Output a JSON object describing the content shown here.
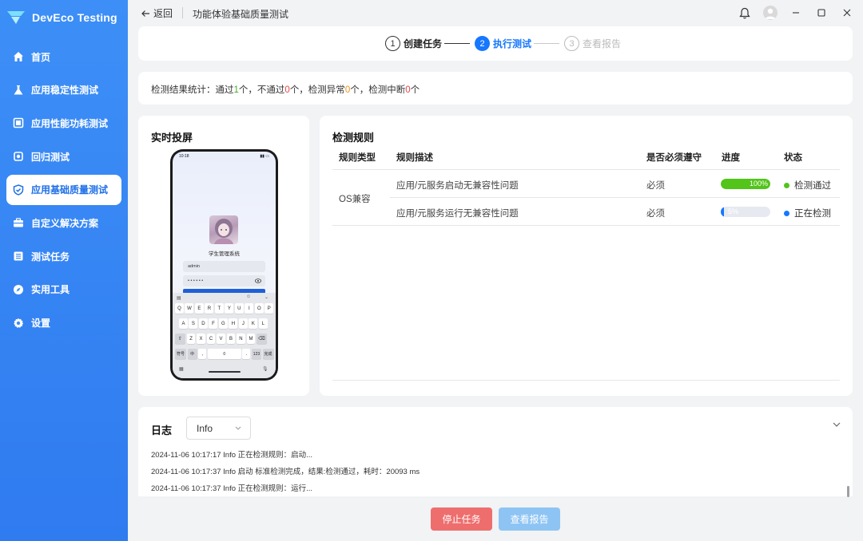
{
  "app": {
    "name": "DevEco Testing"
  },
  "sidebar": {
    "items": [
      {
        "label": "首页",
        "icon": "home-icon"
      },
      {
        "label": "应用稳定性测试",
        "icon": "flask-icon"
      },
      {
        "label": "应用性能功耗测试",
        "icon": "monitor-icon"
      },
      {
        "label": "回归测试",
        "icon": "refresh-icon"
      },
      {
        "label": "应用基础质量测试",
        "icon": "shield-check-icon",
        "active": true
      },
      {
        "label": "自定义解决方案",
        "icon": "toolbox-icon"
      },
      {
        "label": "测试任务",
        "icon": "list-icon"
      },
      {
        "label": "实用工具",
        "icon": "compass-icon"
      },
      {
        "label": "设置",
        "icon": "gear-icon"
      }
    ]
  },
  "titlebar": {
    "back_label": "返回",
    "page_title": "功能体验基础质量测试"
  },
  "steps": [
    {
      "num": "1",
      "label": "创建任务",
      "state": "done"
    },
    {
      "num": "2",
      "label": "执行测试",
      "state": "active"
    },
    {
      "num": "3",
      "label": "查看报告",
      "state": "pending"
    }
  ],
  "summary": {
    "prefix": "检测结果统计：通过",
    "pass_count": "1",
    "after_pass": "个，不通过",
    "fail_count": "0",
    "after_fail": "个，检测异常",
    "error_count": "0",
    "after_error": "个，检测中断",
    "interrupt_count": "0",
    "suffix": "个"
  },
  "screen": {
    "title": "实时投屏",
    "phone": {
      "time": "10:18",
      "app_title": "学生管理系统",
      "username_value": "admin",
      "password_mask": "• • • • • •",
      "keyboard_row1": [
        "Q",
        "W",
        "E",
        "R",
        "T",
        "Y",
        "U",
        "I",
        "O",
        "P"
      ],
      "keyboard_row2": [
        "A",
        "S",
        "D",
        "F",
        "G",
        "H",
        "J",
        "K",
        "L"
      ],
      "keyboard_row3": [
        "Z",
        "X",
        "C",
        "V",
        "B",
        "N",
        "M"
      ],
      "keyboard_bottom": {
        "symbols": "符号",
        "lang": "中",
        "comma": ",",
        "space_num": "0",
        "period": ".",
        "num": "123",
        "done": "完成"
      }
    }
  },
  "rules": {
    "title": "检测规则",
    "columns": [
      "规则类型",
      "规则描述",
      "是否必须遵守",
      "进度",
      "状态"
    ],
    "category": "OS兼容",
    "rows": [
      {
        "desc": "应用/元服务启动无兼容性问题",
        "required": "必须",
        "progress": 100,
        "progress_label": "100%",
        "status": "检测通过",
        "status_color": "#52c41a",
        "bar_color": "#52c41a"
      },
      {
        "desc": "应用/元服务运行无兼容性问题",
        "required": "必须",
        "progress": 6,
        "progress_label": "5%",
        "status": "正在检测",
        "status_color": "#1677ff",
        "bar_color": "#1677ff"
      }
    ]
  },
  "log": {
    "title": "日志",
    "level": "Info",
    "lines": [
      "2024-11-06 10:17:17 Info 正在检测规则：启动...",
      "2024-11-06 10:17:37 Info 启动 标准检测完成，结果:检测通过，耗时：20093 ms",
      "2024-11-06 10:17:37 Info 正在检测规则：运行..."
    ]
  },
  "actions": {
    "stop_label": "停止任务",
    "report_label": "查看报告",
    "stop_color": "#ee6e6e",
    "report_color": "#8ec4f4"
  }
}
